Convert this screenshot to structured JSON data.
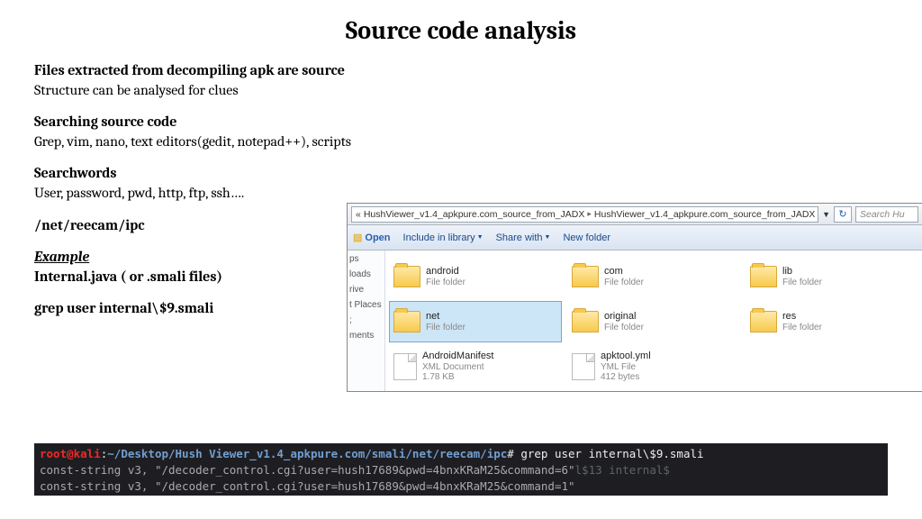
{
  "title": "Source code analysis",
  "bullets": {
    "b1h": "Files extracted from decompiling apk are source",
    "b1": "Structure can be analysed for clues",
    "b2h": "Searching source code",
    "b2": "Grep, vim, nano, text editors(gedit, notepad++), scripts",
    "b3h": "Searchwords",
    "b3": "User, password, pwd, http, ftp, ssh….",
    "b4": "/net/reecam/ipc",
    "b5ex": "Example",
    "b5": "Internal.java ( or .smali files)",
    "b6": "grep user internal\\$9.smali"
  },
  "explorer": {
    "breadcrumb": {
      "sep": "«",
      "p1": "HushViewer_v1.4_apkpure.com_source_from_JADX",
      "p2": "HushViewer_v1.4_apkpure.com_source_from_JADX"
    },
    "search_placeholder": "Search Hu",
    "toolbar": {
      "open": "Open",
      "include": "Include in library",
      "share": "Share with",
      "newf": "New folder"
    },
    "sidebar": {
      "s1": "ps",
      "s2": "loads",
      "s3": "rive",
      "s4": "t Places",
      "s5": ";",
      "s6": "ments"
    },
    "items": [
      {
        "name": "android",
        "meta": "File folder",
        "type": "folder"
      },
      {
        "name": "com",
        "meta": "File folder",
        "type": "folder"
      },
      {
        "name": "lib",
        "meta": "File folder",
        "type": "folder"
      },
      {
        "name": "net",
        "meta": "File folder",
        "type": "folder",
        "selected": true
      },
      {
        "name": "original",
        "meta": "File folder",
        "type": "folder"
      },
      {
        "name": "res",
        "meta": "File folder",
        "type": "folder"
      },
      {
        "name": "AndroidManifest",
        "meta": "XML Document",
        "meta2": "1.78 KB",
        "type": "file"
      },
      {
        "name": "apktool.yml",
        "meta": "YML File",
        "meta2": "412 bytes",
        "type": "file"
      }
    ]
  },
  "terminal": {
    "user": "root@kali",
    "colon": ":",
    "path": "~/Desktop/Hush Viewer_v1.4_apkpure.com/smali/net/reecam/ipc",
    "hash": "#",
    "cmd": " grep user internal\\$9.smali",
    "l1a": "    const-string v3, ",
    "l1b": "\"/decoder_control.cgi?user=hush17689&pwd=4bnxKRaM25&command=6\"",
    "l1c": "l$13   internal$",
    "l2a": "    const-string v3, ",
    "l2b": "\"/decoder_control.cgi?user=hush17689&pwd=4bnxKRaM25&command=1\""
  }
}
